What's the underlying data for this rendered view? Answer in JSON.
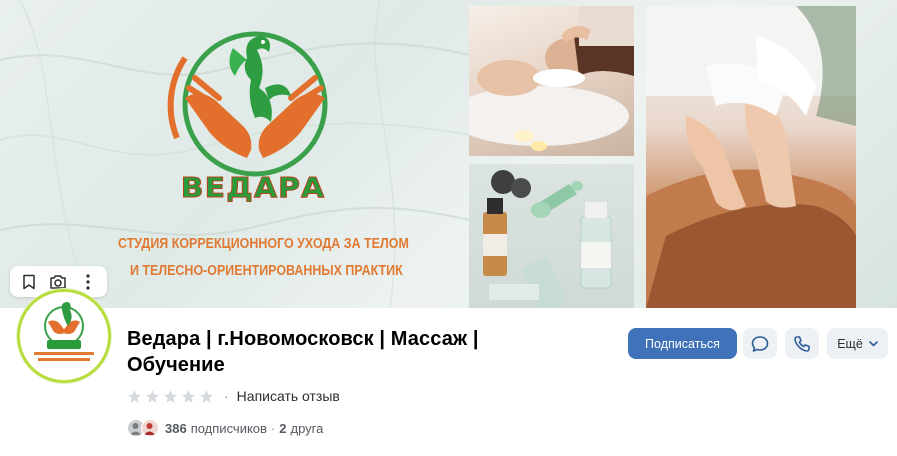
{
  "cover": {
    "brand_name": "ВЕДАРА",
    "tagline_line1": "СТУДИЯ КОРРЕКЦИОННОГО УХОДА ЗА ТЕЛОМ",
    "tagline_line2": "И ТЕЛЕСНО-ОРИЕНТИРОВАННЫХ ПРАКТИК",
    "tools": {
      "bookmark_icon": "bookmark-icon",
      "camera_icon": "camera-icon",
      "more_icon": "vertical-dots-icon"
    }
  },
  "group": {
    "title": "Ведара | г.Новомосковск | Массаж | Обучение",
    "rating_stars": 5,
    "rating_value": 0,
    "rating_separator": "·",
    "review_link": "Написать отзыв",
    "subscribers_count": "386",
    "subscribers_label": "подписчиков",
    "friends_separator": "·",
    "friends_count": "2",
    "friends_label": "друга"
  },
  "actions": {
    "subscribe_label": "Подписаться",
    "message_icon": "message-icon",
    "phone_icon": "phone-icon",
    "more_label": "Ещё",
    "more_icon": "chevron-down-icon"
  },
  "colors": {
    "accent": "#3f72b9",
    "secondary_button_bg": "#edf0f5",
    "avatar_ring": "#b7dd3f",
    "brand_green": "#2a9a3a",
    "brand_orange": "#e07a33"
  }
}
